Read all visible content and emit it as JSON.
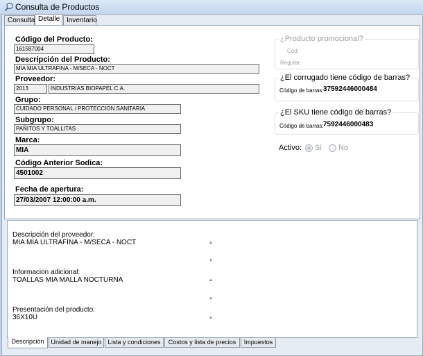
{
  "window": {
    "title": "Consulta de Productos"
  },
  "top_tabs": [
    {
      "label": "Consulta"
    },
    {
      "label": "Detalle"
    },
    {
      "label": "Inventario"
    }
  ],
  "detail": {
    "codigo": {
      "label": "Código del Producto:",
      "value": "161587004"
    },
    "descripcion": {
      "label": "Descripción del Producto:",
      "value": "MIA MIA ULTRAFINA - M/SECA - NOCT"
    },
    "proveedor": {
      "label": "Proveedor:",
      "code": "2013",
      "name": "INDUSTRIAS BIOPAPEL C.A."
    },
    "grupo": {
      "label": "Grupo:",
      "value": "CUIDADO PERSONAL / PROTECCION SANITARIA"
    },
    "subgrupo": {
      "label": "Subgrupo:",
      "value": "PAÑITOS Y TOALLITAS"
    },
    "marca": {
      "label": "Marca:",
      "value": "MIA"
    },
    "codigo_anterior": {
      "label": "Código Anterior Sodica:",
      "value": "4501002"
    },
    "fecha_apertura": {
      "label": "Fecha de apertura:",
      "value": "27/03/2007 12:00:00 a.m."
    }
  },
  "promo": {
    "title": "¿Producto promocional?",
    "cod_label": "Cod:",
    "regular_label": "Regular:"
  },
  "corrugado": {
    "title": "¿El corrugado tiene código de barras?",
    "barcode_label": "Código de barras:",
    "barcode_value": "37592446000484"
  },
  "sku": {
    "title": "¿El SKU tiene código de barras?",
    "barcode_label": "Código de barras:",
    "barcode_value": "7592446000483"
  },
  "activo": {
    "label": "Activo:",
    "options": [
      "Si",
      "No"
    ],
    "selected": "Si"
  },
  "bottom": {
    "desc_proveedor": {
      "label": "Descripción del proveedor:",
      "value": "MIA MIA ULTRAFINA - M/SECA - NOCT"
    },
    "info_adicional": {
      "label": "Informacion adicional:",
      "value": "TOALLAS MIA MALLA NOCTURNA"
    },
    "presentacion": {
      "label": "Presentación del producto:",
      "value": "36X10U"
    }
  },
  "bottom_tabs": [
    {
      "label": "Descripción"
    },
    {
      "label": "Unidad de manejo"
    },
    {
      "label": "Lista y condiciones"
    },
    {
      "label": "Costos y lista de precios"
    },
    {
      "label": "Impuestos"
    }
  ],
  "icons": {
    "window": "search-icon",
    "scroll_up": "arrow-up-icon",
    "scroll_down": "arrow-down-icon"
  }
}
